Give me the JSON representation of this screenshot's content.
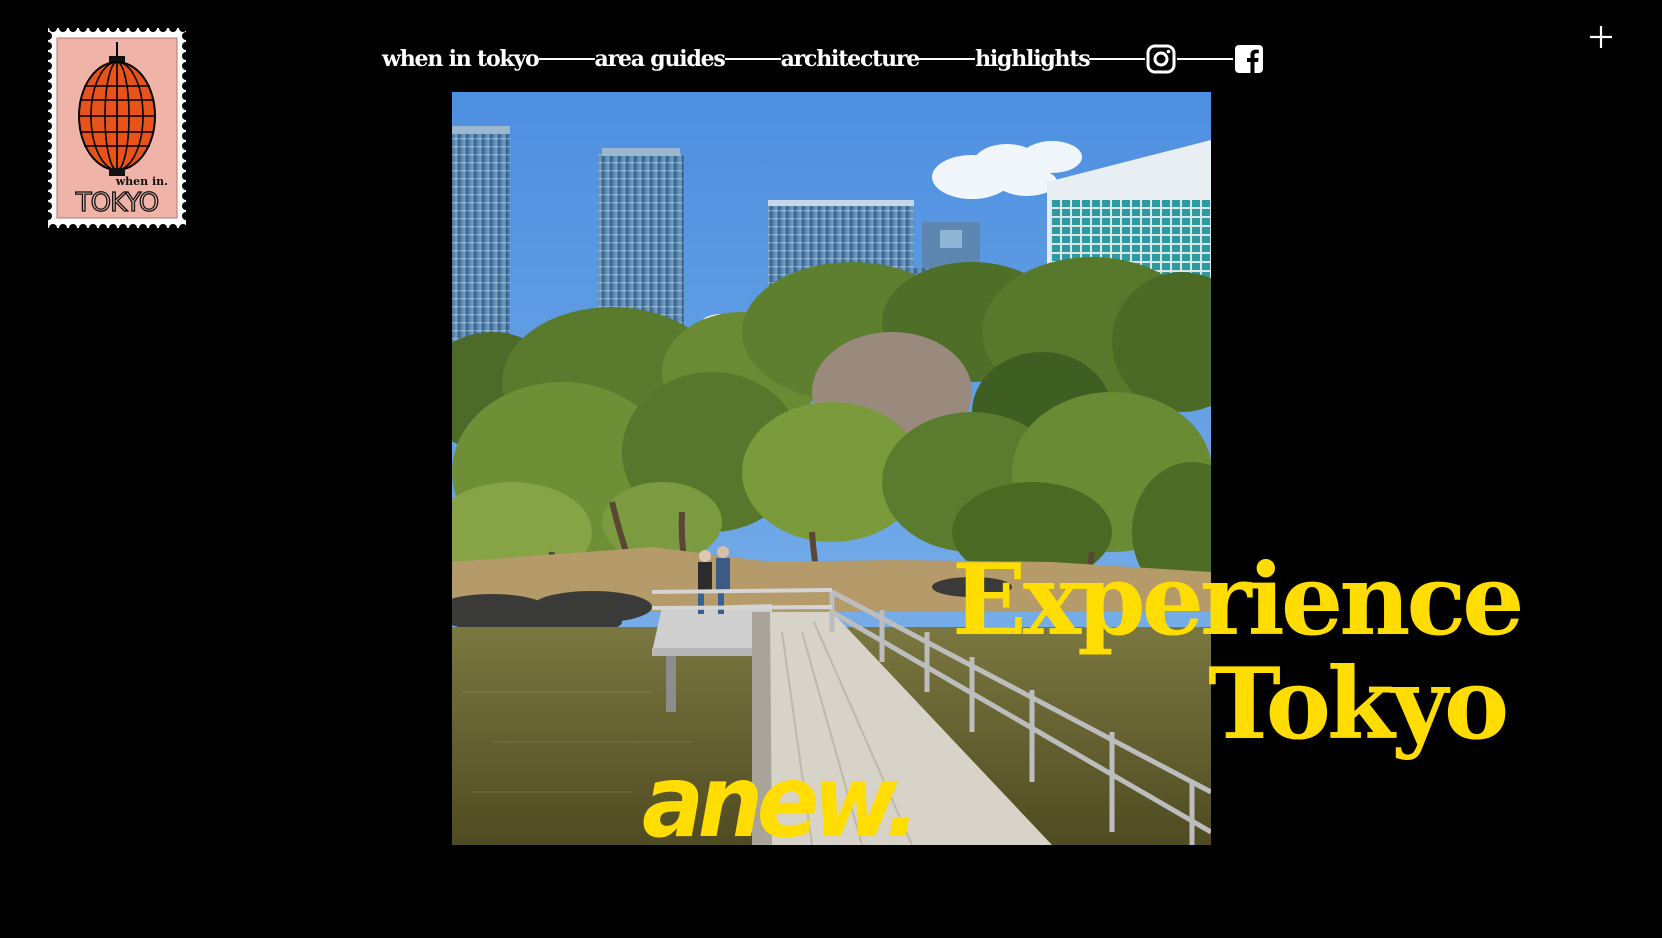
{
  "brand": {
    "stamp_small_text": "when in.",
    "stamp_big_text": "TOKYO"
  },
  "nav": {
    "items": [
      {
        "label": "when in tokyo"
      },
      {
        "label": "area guides"
      },
      {
        "label": "architecture"
      },
      {
        "label": "highlights"
      }
    ],
    "social": [
      "instagram-icon",
      "facebook-icon"
    ]
  },
  "menu": {
    "icon": "plus-icon"
  },
  "hero": {
    "headline_line1": "Experience",
    "headline_line2": "Tokyo",
    "tagline": "anew."
  },
  "colors": {
    "background": "#000000",
    "accent": "#ffdd00",
    "nav_text": "#ffffff",
    "stamp_bg": "#f0b3a8",
    "lantern": "#e8531c"
  }
}
